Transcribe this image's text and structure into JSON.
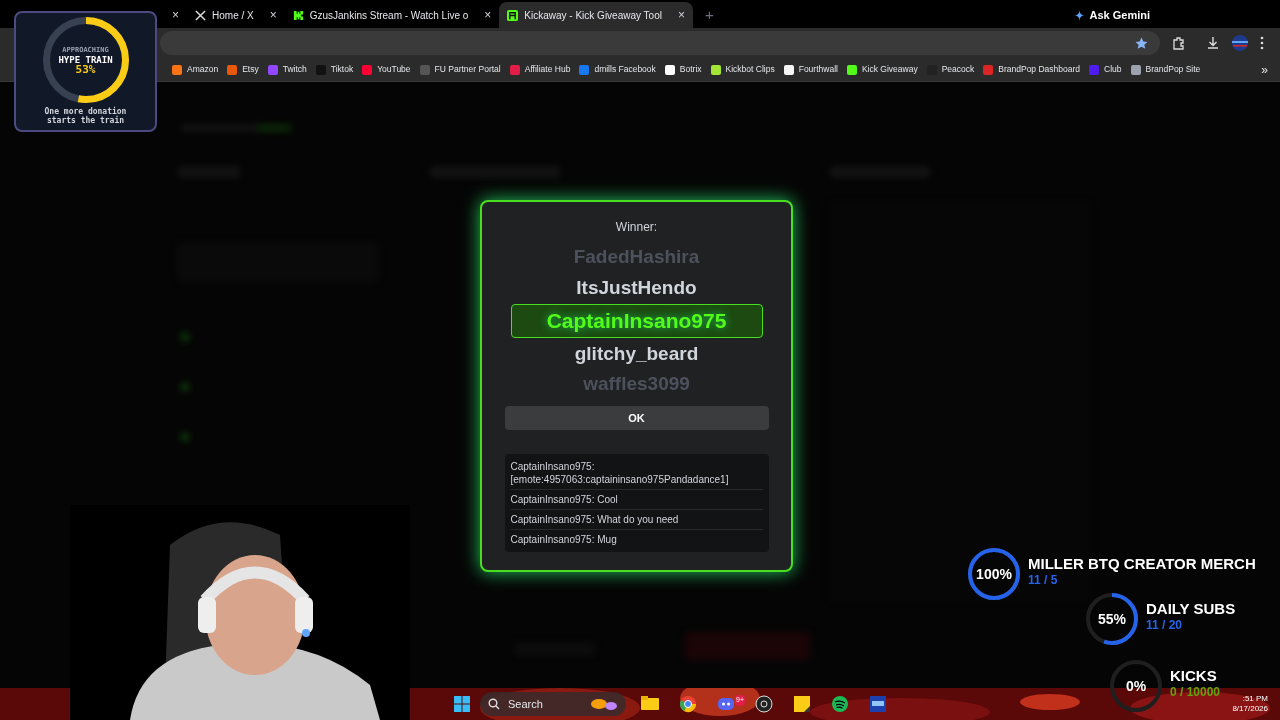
{
  "browser": {
    "tabs": [
      {
        "close": "×",
        "selected": false
      },
      {
        "title": "Home / X",
        "close": "×",
        "selected": false
      },
      {
        "title": "GzusJankins Stream - Watch Live o",
        "close": "×",
        "selected": false
      },
      {
        "title": "Kickaway - Kick Giveaway Tool",
        "close": "×",
        "selected": true
      }
    ],
    "new_tab": "+",
    "gemini": "Ask Gemini",
    "bookmark_starred": true,
    "bookmarks": [
      {
        "label": "Amazon",
        "color": "#f97316"
      },
      {
        "label": "Etsy",
        "color": "#ea580c"
      },
      {
        "label": "Twitch",
        "color": "#9146ff"
      },
      {
        "label": "Tiktok",
        "color": "#111111"
      },
      {
        "label": "YouTube",
        "color": "#ff0033"
      },
      {
        "label": "FU Partner Portal",
        "color": "#555555"
      },
      {
        "label": "Affiliate Hub",
        "color": "#e11d48"
      },
      {
        "label": "dmills Facebook",
        "color": "#1877f2"
      },
      {
        "label": "Botrix",
        "color": "#ffffff"
      },
      {
        "label": "Kickbot Clips",
        "color": "#a3e635"
      },
      {
        "label": "Fourthwall",
        "color": "#f5f5f5"
      },
      {
        "label": "Kick Giveaway",
        "color": "#53fc18"
      },
      {
        "label": "Peacock",
        "color": "#222222"
      },
      {
        "label": "BrandPop Dashboard",
        "color": "#dc2626"
      },
      {
        "label": "Club",
        "color": "#4f1cf0"
      },
      {
        "label": "BrandPop Site",
        "color": "#9ca3af"
      }
    ],
    "more": "»"
  },
  "modal": {
    "heading": "Winner:",
    "names": [
      {
        "name": "FadedHashira",
        "selected": false
      },
      {
        "name": "ItsJustHendo",
        "selected": false
      },
      {
        "name": "CaptainInsano975",
        "selected": true
      },
      {
        "name": "glitchy_beard",
        "selected": false
      },
      {
        "name": "waffles3099",
        "selected": false
      }
    ],
    "ok": "OK",
    "messages": [
      "CaptainInsano975: [emote:4957063:captaininsano975Pandadance1]",
      "CaptainInsano975: Cool",
      "CaptainInsano975: What do you need",
      "CaptainInsano975: Mug"
    ]
  },
  "hype_train": {
    "top": "APPROACHING",
    "title": "HYPE TRAIN",
    "percent": "53%",
    "level": 0.53,
    "caption": "One more donation starts the train"
  },
  "goals": [
    {
      "percent": "100%",
      "title": "MILLER BTQ CREATOR MERCH",
      "progress": "11 / 5",
      "level": 1,
      "color": "#2563eb"
    },
    {
      "percent": "55%",
      "title": "DAILY SUBS",
      "progress": "11 / 20",
      "level": 0.55,
      "color": "#2563eb"
    },
    {
      "percent": "0%",
      "title": "KICKS",
      "progress": "0 / 10000",
      "level": 0,
      "color": "#65a30d"
    }
  ],
  "taskbar": {
    "search": "Search",
    "time": ":51 PM",
    "date": "8/17/2026",
    "discord_badge": "9+"
  }
}
